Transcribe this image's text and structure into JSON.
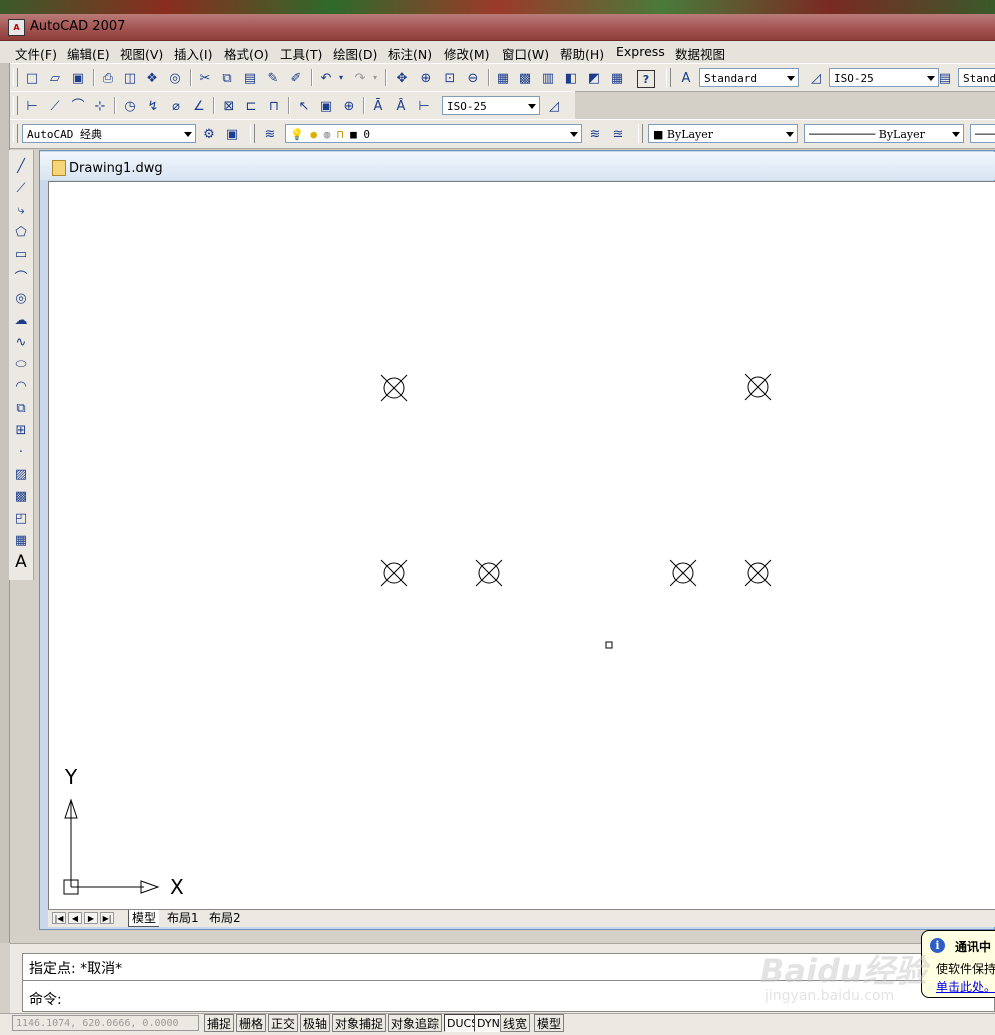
{
  "window": {
    "title": "AutoCAD 2007"
  },
  "menu": [
    "文件(F)",
    "编辑(E)",
    "视图(V)",
    "插入(I)",
    "格式(O)",
    "工具(T)",
    "绘图(D)",
    "标注(N)",
    "修改(M)",
    "窗口(W)",
    "帮助(H)",
    "Express",
    "数据视图"
  ],
  "toolbar1": {
    "text_style": "Standard",
    "dim_style": "ISO-25",
    "table_style": "Standard"
  },
  "toolbar2": {
    "dim_style": "ISO-25"
  },
  "toolbar3": {
    "workspace": "AutoCAD 经典",
    "layer": "0",
    "color": "ByLayer",
    "linetype": "ByLayer"
  },
  "document": {
    "title": "Drawing1.dwg"
  },
  "ucs": {
    "x_label": "X",
    "y_label": "Y"
  },
  "layout_tabs": [
    "模型",
    "布局1",
    "布局2"
  ],
  "command": {
    "history": "指定点: *取消*",
    "prompt": "命令:"
  },
  "status": {
    "coords": "1146.1074, 620.0666, 0.0000",
    "buttons": [
      {
        "label": "捕捉",
        "on": false
      },
      {
        "label": "栅格",
        "on": false
      },
      {
        "label": "正交",
        "on": false
      },
      {
        "label": "极轴",
        "on": false
      },
      {
        "label": "对象捕捉",
        "on": false
      },
      {
        "label": "对象追踪",
        "on": false
      },
      {
        "label": "DUCS",
        "on": true
      },
      {
        "label": "DYN",
        "on": true
      },
      {
        "label": "线宽",
        "on": false
      },
      {
        "label": "模型",
        "on": false
      }
    ]
  },
  "notification": {
    "title": "通讯中",
    "body": "使软件保持",
    "link": "单击此处。"
  },
  "watermark": {
    "text": "Baidu经验",
    "url": "jingyan.baidu.com"
  },
  "colors": {
    "title_bar": "#a45552",
    "canvas": "#ffffff",
    "doc_frame": "#c9d8ea"
  }
}
